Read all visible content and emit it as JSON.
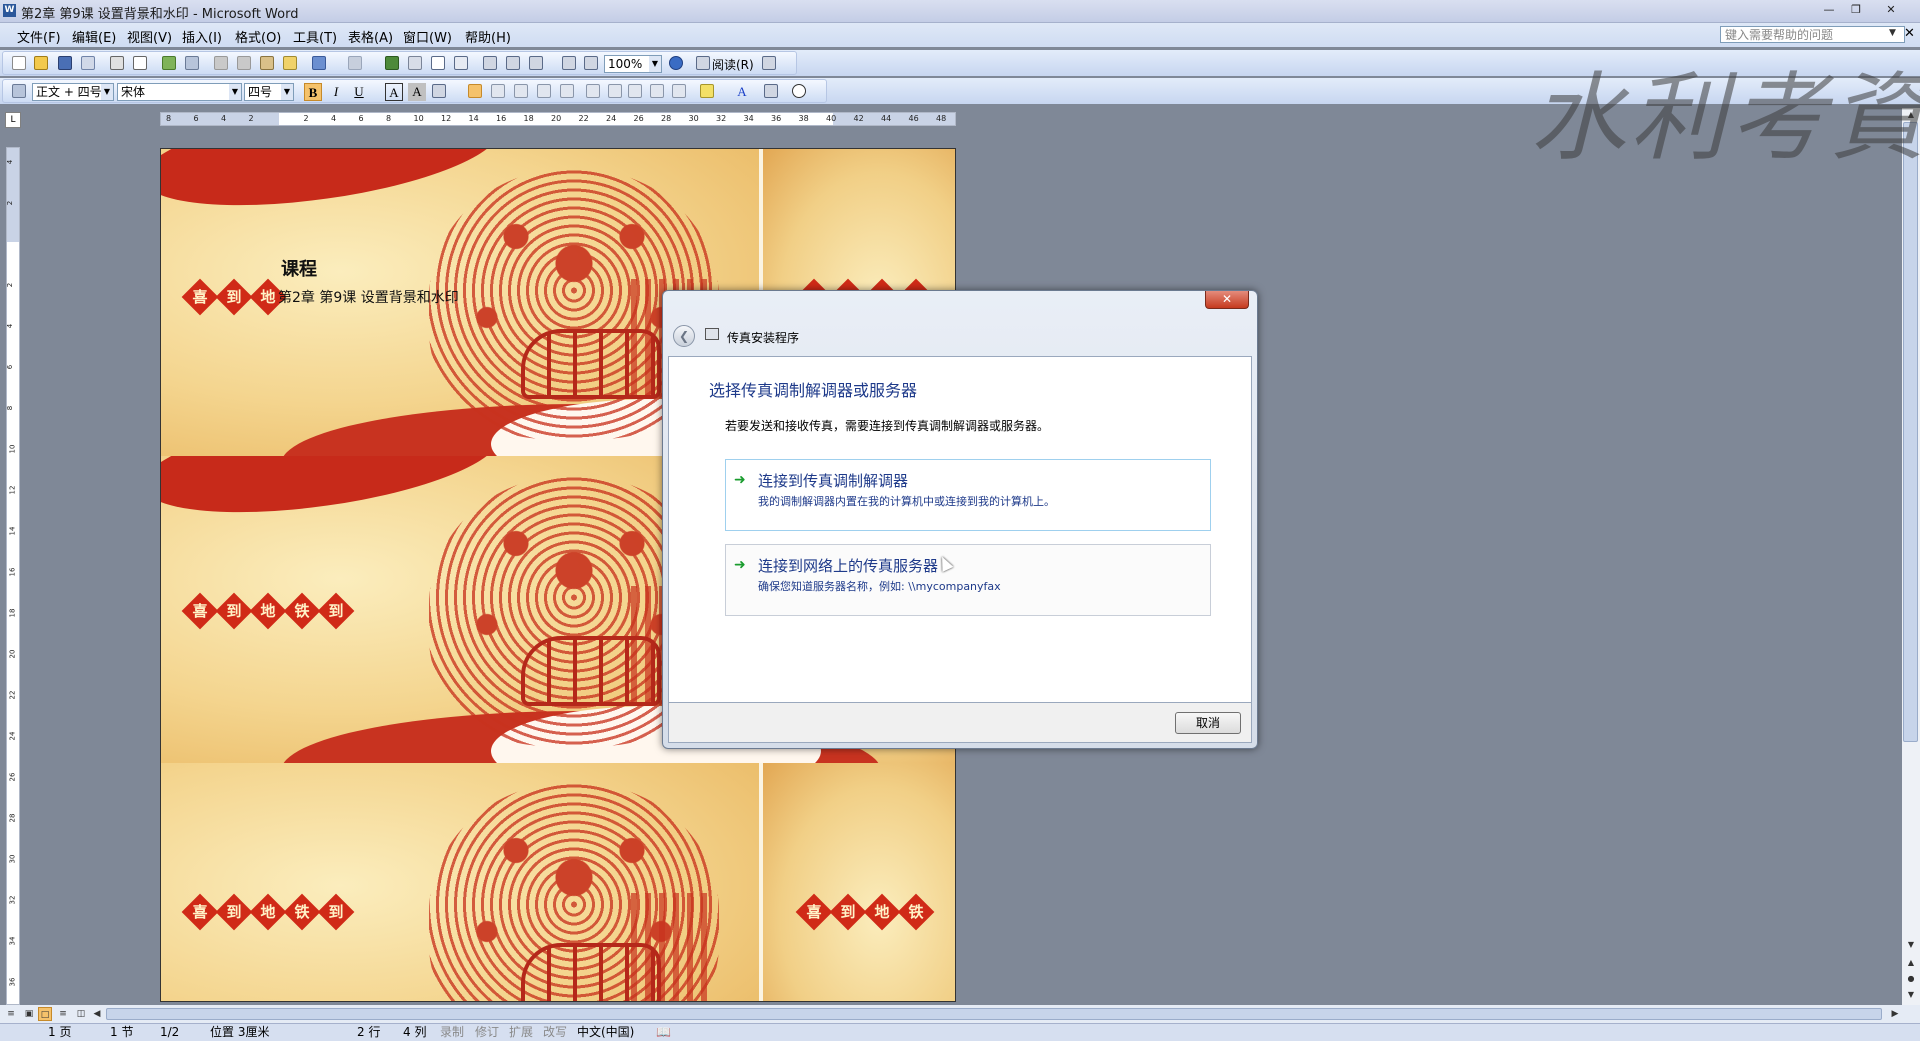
{
  "window": {
    "title": "第2章 第9课 设置背景和水印 - Microsoft Word",
    "app_icon": "W",
    "controls": [
      "minimize-icon",
      "restore-icon",
      "close-icon"
    ]
  },
  "menu": {
    "items": [
      "文件(F)",
      "编辑(E)",
      "视图(V)",
      "插入(I)",
      "格式(O)",
      "工具(T)",
      "表格(A)",
      "窗口(W)",
      "帮助(H)"
    ],
    "help_placeholder": "键入需要帮助的问题"
  },
  "standard_toolbar": {
    "zoom": "100%",
    "read_label": "阅读(R)"
  },
  "format_toolbar": {
    "style": "正文 + 四号",
    "font": "宋体",
    "size": "四号",
    "bold": "B",
    "italic": "I",
    "underline": "U",
    "char_border": "A",
    "char_shade": "A",
    "font_color": "A"
  },
  "ruler": {
    "corner": "L",
    "h_ticks": [
      "8",
      "6",
      "4",
      "2",
      "",
      "2",
      "4",
      "6",
      "8",
      "10",
      "12",
      "14",
      "16",
      "18",
      "20",
      "22",
      "24",
      "26",
      "28",
      "30",
      "32",
      "34",
      "36",
      "38",
      "40",
      "42",
      "44",
      "46",
      "48"
    ],
    "v_ticks": [
      "4",
      "2",
      "",
      "2",
      "4",
      "6",
      "8",
      "10",
      "12",
      "14",
      "16",
      "18",
      "20",
      "22",
      "24",
      "26",
      "28",
      "30",
      "32",
      "34",
      "36"
    ]
  },
  "document": {
    "heading": "课程",
    "subline": "第2章 第9课 设置背景和水印",
    "badge_text": [
      "喜",
      "到",
      "地",
      "铁",
      "到"
    ]
  },
  "dialog": {
    "window_title": "传真安装程序",
    "heading": "选择传真调制解调器或服务器",
    "description": "若要发送和接收传真，需要连接到传真调制解调器或服务器。",
    "options": [
      {
        "title": "连接到传真调制解调器",
        "desc": "我的调制解调器内置在我的计算机中或连接到我的计算机上。"
      },
      {
        "title": "连接到网络上的传真服务器",
        "desc": "确保您知道服务器名称，例如: \\\\mycompanyfax"
      }
    ],
    "cancel_label": "取消"
  },
  "status": {
    "page": "1 页",
    "section": "1 节",
    "page_of": "1/2",
    "position": "位置 3厘米",
    "line": "2 行",
    "column": "4 列",
    "rec": "录制",
    "trk": "修订",
    "ext": "扩展",
    "ovr": "改写",
    "language": "中文(中国)"
  },
  "watermark_text": "水利考資",
  "colors": {
    "accent_blue": "#1e3a8a",
    "workspace": "#7f8897",
    "papercut_red": "#c8321d",
    "option_arrow": "#1a9c2e"
  }
}
